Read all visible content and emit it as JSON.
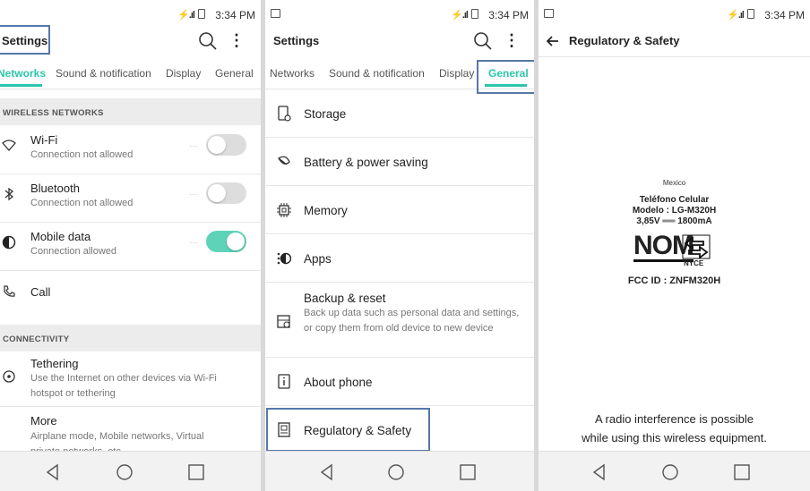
{
  "status": {
    "time": "3:34 PM",
    "signal": "⚡.ıl"
  },
  "colors": {
    "accent": "#2cc5ab",
    "toggle_on": "#5fd3b8",
    "highlight": "#5778a8"
  },
  "p1": {
    "title": "Settings",
    "tabs": [
      "Networks",
      "Sound & notification",
      "Display",
      "General"
    ],
    "wireless_header": "WIRELESS NETWORKS",
    "wifi": {
      "title": "Wi-Fi",
      "sub": "Connection not allowed",
      "on": false,
      "icon": "wifi-icon"
    },
    "bluetooth": {
      "title": "Bluetooth",
      "sub": "Connection not allowed",
      "on": false,
      "icon": "bluetooth-icon"
    },
    "mobile": {
      "title": "Mobile data",
      "sub": "Connection allowed",
      "on": true,
      "icon": "mobile-data-icon"
    },
    "call": {
      "title": "Call",
      "icon": "phone-icon"
    },
    "connectivity_header": "CONNECTIVITY",
    "tethering": {
      "title": "Tethering",
      "sub1": "Use the Internet on other devices via Wi-Fi",
      "sub2": "hotspot or tethering",
      "icon": "tethering-icon"
    },
    "more": {
      "title": "More",
      "sub1": "Airplane mode, Mobile networks, Virtual",
      "sub2": "private networks, etc.",
      "icon": "more-icon"
    },
    "dots": "···"
  },
  "p2": {
    "title": "Settings",
    "tabs": [
      "Networks",
      "Sound & notification",
      "Display",
      "General"
    ],
    "storage": "Storage",
    "battery": "Battery & power saving",
    "memory": "Memory",
    "apps": "Apps",
    "backup": {
      "title": "Backup & reset",
      "sub": "Back up data such as personal data and settings, or copy them from old device to new device"
    },
    "about": "About phone",
    "regulatory": "Regulatory & Safety"
  },
  "p3": {
    "title": "Regulatory & Safety",
    "country": "Mexico",
    "phone_label": "Teléfono Celular",
    "model_label": "Modelo : LG-M320H",
    "power_label": "3,85V ══ 1800mA",
    "nom": "NOM",
    "nyce": "NYCE",
    "fcc": "FCC ID : ZNFM320H",
    "notice1": "A radio interference is possible",
    "notice2": "while using this wireless equipment."
  }
}
